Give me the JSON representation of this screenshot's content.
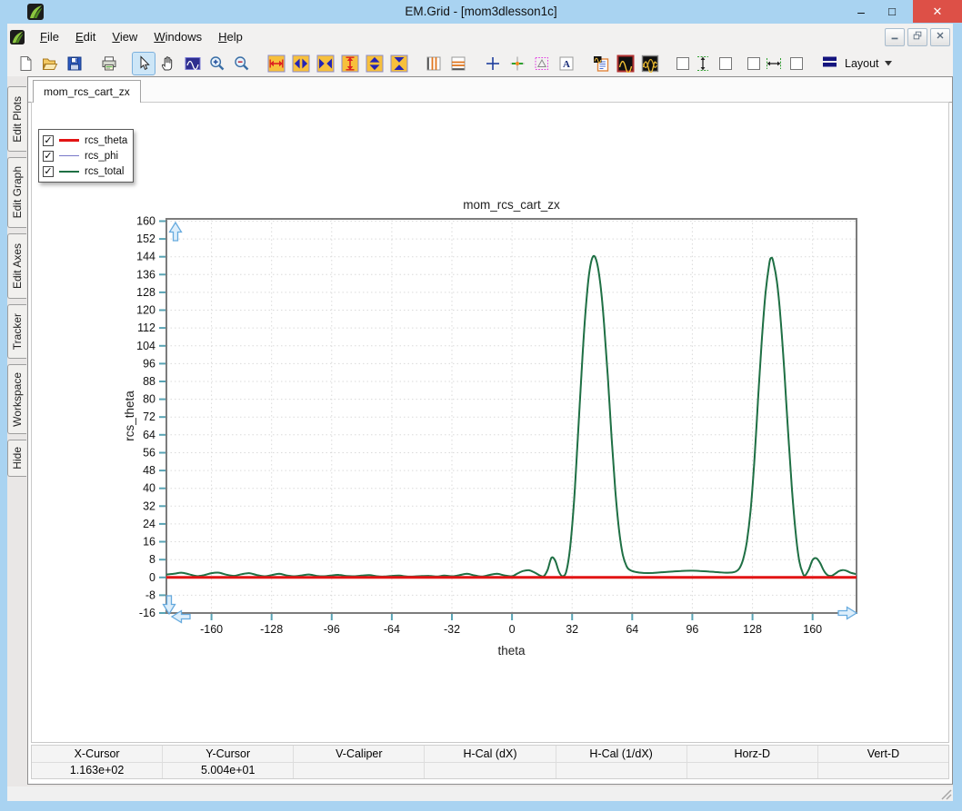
{
  "window": {
    "title": "EM.Grid - [mom3dlesson1c]",
    "controls": [
      "minimize",
      "maximize",
      "close"
    ]
  },
  "menu": {
    "items": [
      "File",
      "Edit",
      "View",
      "Windows",
      "Help"
    ]
  },
  "mdi_controls": [
    "minimize",
    "restore",
    "close"
  ],
  "toolbar": {
    "layout_label": "Layout",
    "items": [
      {
        "name": "new-file"
      },
      {
        "name": "open-file"
      },
      {
        "name": "save-file"
      },
      {
        "name": "print",
        "gap_before": true
      },
      {
        "name": "select-pointer",
        "gap_before": true,
        "active": true
      },
      {
        "name": "pan-hand"
      },
      {
        "name": "zoom-window"
      },
      {
        "name": "zoom-in"
      },
      {
        "name": "zoom-out"
      },
      {
        "name": "fit-width",
        "gap_before": true
      },
      {
        "name": "expand-horizontal"
      },
      {
        "name": "shrink-horizontal"
      },
      {
        "name": "fit-height"
      },
      {
        "name": "expand-vertical"
      },
      {
        "name": "shrink-vertical"
      },
      {
        "name": "vertical-markers",
        "gap_before": true
      },
      {
        "name": "horizontal-markers"
      },
      {
        "name": "crosshair-cursor",
        "gap_before": true
      },
      {
        "name": "tracker-cursor"
      },
      {
        "name": "caliper"
      },
      {
        "name": "text-annotation"
      },
      {
        "name": "plot-properties",
        "gap_before": true
      },
      {
        "name": "show-curve"
      },
      {
        "name": "show-curves"
      },
      {
        "name": "v-space-checkbox-left",
        "type": "checkbox",
        "gap_before": true
      },
      {
        "name": "vertical-spacing"
      },
      {
        "name": "v-space-checkbox-right",
        "type": "checkbox"
      },
      {
        "name": "h-space-checkbox-left",
        "type": "checkbox",
        "gap_before": true
      },
      {
        "name": "horizontal-spacing"
      },
      {
        "name": "h-space-checkbox-right",
        "type": "checkbox"
      },
      {
        "name": "layout-menu",
        "type": "dropdown",
        "label": "Layout",
        "gap_before": true
      }
    ]
  },
  "sidebar": {
    "tabs": [
      "Edit Plots",
      "Edit Graph",
      "Edit Axes",
      "Tracker",
      "Workspace",
      "Hide"
    ]
  },
  "document": {
    "tab": "mom_rcs_cart_zx"
  },
  "legend": {
    "series": [
      {
        "label": "rcs_theta",
        "color": "#e21414",
        "thickness": 3,
        "checked": true
      },
      {
        "label": "rcs_phi",
        "color": "#7878c8",
        "thickness": 1.5,
        "checked": true
      },
      {
        "label": "rcs_total",
        "color": "#1f7044",
        "thickness": 2,
        "checked": true
      }
    ]
  },
  "chart_data": {
    "type": "line",
    "title": "mom_rcs_cart_zx",
    "xlabel": "theta",
    "ylabel": "rcs_theta",
    "xlim": [
      -184,
      183.4
    ],
    "ylim": [
      -16,
      161
    ],
    "xticks": [
      -160,
      -128,
      -96,
      -64,
      -32,
      0,
      32,
      64,
      96,
      128,
      160
    ],
    "yticks": [
      160,
      152,
      144,
      136,
      128,
      120,
      112,
      104,
      96,
      88,
      80,
      72,
      64,
      56,
      48,
      40,
      32,
      24,
      16,
      8,
      0,
      -8,
      -16
    ],
    "grid": "dotted",
    "grid_color": "#dadada",
    "tick_color": "#58a3b4",
    "border_color": "#7c7c7c",
    "legend_position": "top-left-floating",
    "draw_order": [
      "rcs_phi",
      "rcs_total",
      "rcs_theta"
    ],
    "series": [
      {
        "name": "rcs_theta",
        "color": "#e21414",
        "width": 3,
        "points": [
          [
            -184,
            0
          ],
          [
            183.4,
            0
          ]
        ]
      },
      {
        "name": "rcs_phi",
        "color": "#7878c8",
        "width": 1.5,
        "points_same_as": "rcs_total",
        "note": "hidden beneath rcs_total curve"
      },
      {
        "name": "rcs_total",
        "color": "#1f7044",
        "width": 2,
        "points": [
          [
            -184,
            1.3
          ],
          [
            -180,
            1.6
          ],
          [
            -176,
            2.1
          ],
          [
            -172,
            1.4
          ],
          [
            -168,
            0.6
          ],
          [
            -164,
            1.0
          ],
          [
            -160,
            1.9
          ],
          [
            -156,
            2.1
          ],
          [
            -152,
            1.2
          ],
          [
            -148,
            0.7
          ],
          [
            -144,
            1.4
          ],
          [
            -140,
            1.9
          ],
          [
            -136,
            1.1
          ],
          [
            -132,
            0.5
          ],
          [
            -128,
            1.0
          ],
          [
            -124,
            1.6
          ],
          [
            -120,
            0.9
          ],
          [
            -116,
            0.5
          ],
          [
            -112,
            0.9
          ],
          [
            -108,
            1.3
          ],
          [
            -104,
            0.7
          ],
          [
            -100,
            0.5
          ],
          [
            -96,
            0.9
          ],
          [
            -92,
            1.1
          ],
          [
            -88,
            0.6
          ],
          [
            -84,
            0.5
          ],
          [
            -80,
            0.8
          ],
          [
            -76,
            1.0
          ],
          [
            -72,
            0.5
          ],
          [
            -68,
            0.4
          ],
          [
            -64,
            0.7
          ],
          [
            -60,
            0.8
          ],
          [
            -56,
            0.4
          ],
          [
            -52,
            0.4
          ],
          [
            -48,
            0.6
          ],
          [
            -44,
            0.7
          ],
          [
            -40,
            0.4
          ],
          [
            -36,
            0.8
          ],
          [
            -32,
            0.5
          ],
          [
            -28,
            1.0
          ],
          [
            -24,
            1.6
          ],
          [
            -20,
            0.9
          ],
          [
            -16,
            0.4
          ],
          [
            -12,
            1.1
          ],
          [
            -8,
            1.6
          ],
          [
            -4,
            0.9
          ],
          [
            0,
            0.5
          ],
          [
            3,
            1.8
          ],
          [
            6,
            2.9
          ],
          [
            9,
            3.2
          ],
          [
            12,
            2.2
          ],
          [
            15,
            0.8
          ],
          [
            17,
            0.6
          ],
          [
            19,
            3.5
          ],
          [
            21,
            8.8
          ],
          [
            23,
            7.5
          ],
          [
            25,
            2.5
          ],
          [
            27,
            0.5
          ],
          [
            29,
            3
          ],
          [
            31,
            14
          ],
          [
            33,
            34
          ],
          [
            35,
            62
          ],
          [
            37,
            92
          ],
          [
            39,
            118
          ],
          [
            41,
            136
          ],
          [
            43,
            144
          ],
          [
            45,
            142
          ],
          [
            47,
            132
          ],
          [
            49,
            114
          ],
          [
            51,
            90
          ],
          [
            53,
            63
          ],
          [
            55,
            39
          ],
          [
            57,
            21
          ],
          [
            59,
            10
          ],
          [
            61,
            5
          ],
          [
            63,
            3.2
          ],
          [
            66,
            2.4
          ],
          [
            70,
            2.0
          ],
          [
            75,
            2.0
          ],
          [
            80,
            2.3
          ],
          [
            85,
            2.6
          ],
          [
            90,
            2.9
          ],
          [
            95,
            3.0
          ],
          [
            100,
            2.9
          ],
          [
            105,
            2.6
          ],
          [
            110,
            2.3
          ],
          [
            114,
            2.1
          ],
          [
            117,
            2.2
          ],
          [
            119,
            2.6
          ],
          [
            121,
            4
          ],
          [
            123,
            8
          ],
          [
            125,
            16
          ],
          [
            127,
            30
          ],
          [
            129,
            52
          ],
          [
            131,
            80
          ],
          [
            133,
            107
          ],
          [
            135,
            128
          ],
          [
            137,
            141
          ],
          [
            138,
            143.5
          ],
          [
            139,
            142
          ],
          [
            141,
            133
          ],
          [
            143,
            116
          ],
          [
            145,
            92
          ],
          [
            147,
            65
          ],
          [
            149,
            40
          ],
          [
            151,
            20
          ],
          [
            153,
            7
          ],
          [
            155,
            1.5
          ],
          [
            156,
            0.8
          ],
          [
            158,
            3.5
          ],
          [
            160,
            7.8
          ],
          [
            162,
            8.6
          ],
          [
            164,
            6.5
          ],
          [
            166,
            3
          ],
          [
            168,
            1.0
          ],
          [
            170,
            0.7
          ],
          [
            172,
            1.6
          ],
          [
            174,
            2.8
          ],
          [
            176,
            3.3
          ],
          [
            178,
            3.0
          ],
          [
            180,
            2.2
          ],
          [
            183,
            1.5
          ]
        ]
      }
    ]
  },
  "status_bar": {
    "columns": [
      {
        "label": "X-Cursor",
        "value": "1.163e+02"
      },
      {
        "label": "Y-Cursor",
        "value": "5.004e+01"
      },
      {
        "label": "V-Caliper",
        "value": ""
      },
      {
        "label": "H-Cal (dX)",
        "value": ""
      },
      {
        "label": "H-Cal (1/dX)",
        "value": ""
      },
      {
        "label": "Horz-D",
        "value": ""
      },
      {
        "label": "Vert-D",
        "value": ""
      }
    ]
  }
}
